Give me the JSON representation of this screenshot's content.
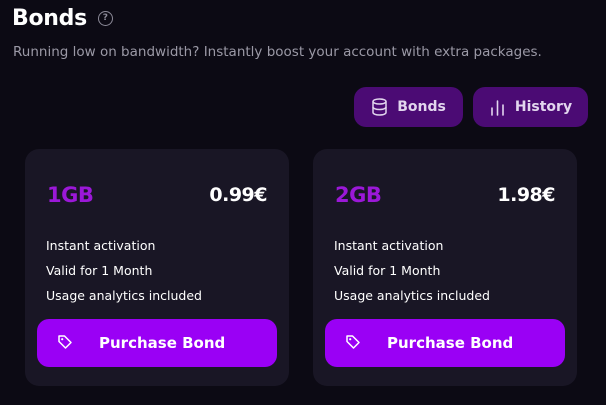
{
  "header": {
    "title": "Bonds",
    "help_glyph": "?",
    "subtitle": "Running low on bandwidth? Instantly boost your account with extra packages."
  },
  "toolbar": {
    "bonds_label": "Bonds",
    "bonds_icon": "database-icon",
    "history_label": "History",
    "history_icon": "bar-chart-icon"
  },
  "cards": [
    {
      "size": "1GB",
      "price": "0.99€",
      "features": [
        "Instant activation",
        "Valid for 1 Month",
        "Usage analytics included"
      ],
      "button_label": "Purchase Bond",
      "button_icon": "tag-icon"
    },
    {
      "size": "2GB",
      "price": "1.98€",
      "features": [
        "Instant activation",
        "Valid for 1 Month",
        "Usage analytics included"
      ],
      "button_label": "Purchase Bond",
      "button_icon": "tag-icon"
    }
  ],
  "colors": {
    "background": "#0c0a14",
    "card": "#191625",
    "accent": "#9a00f5",
    "accent_dark": "#4b0b74",
    "size_text": "#9b18d8",
    "muted_text": "#9b99a6"
  }
}
